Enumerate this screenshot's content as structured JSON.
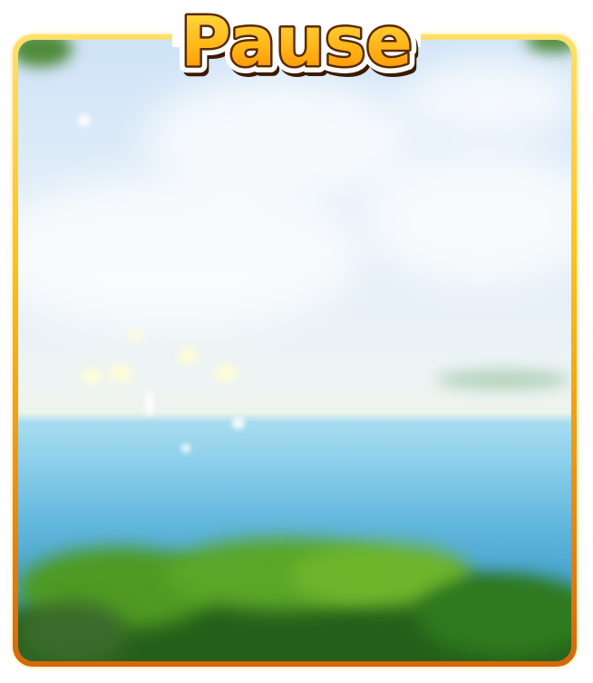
{
  "pause_dialog": {
    "title": "Pause",
    "colors": {
      "frame_gold": "#ffc21a",
      "frame_orange": "#d8660a",
      "title_fill_top": "#ffe14a",
      "title_fill_bottom": "#ff8a00",
      "title_outline": "#5a2a00",
      "sky": "#dcebf8",
      "sea": "#4aa6d2",
      "foliage": "#2f7a1e"
    },
    "background_scene": "blurred-seaside-landscape"
  }
}
